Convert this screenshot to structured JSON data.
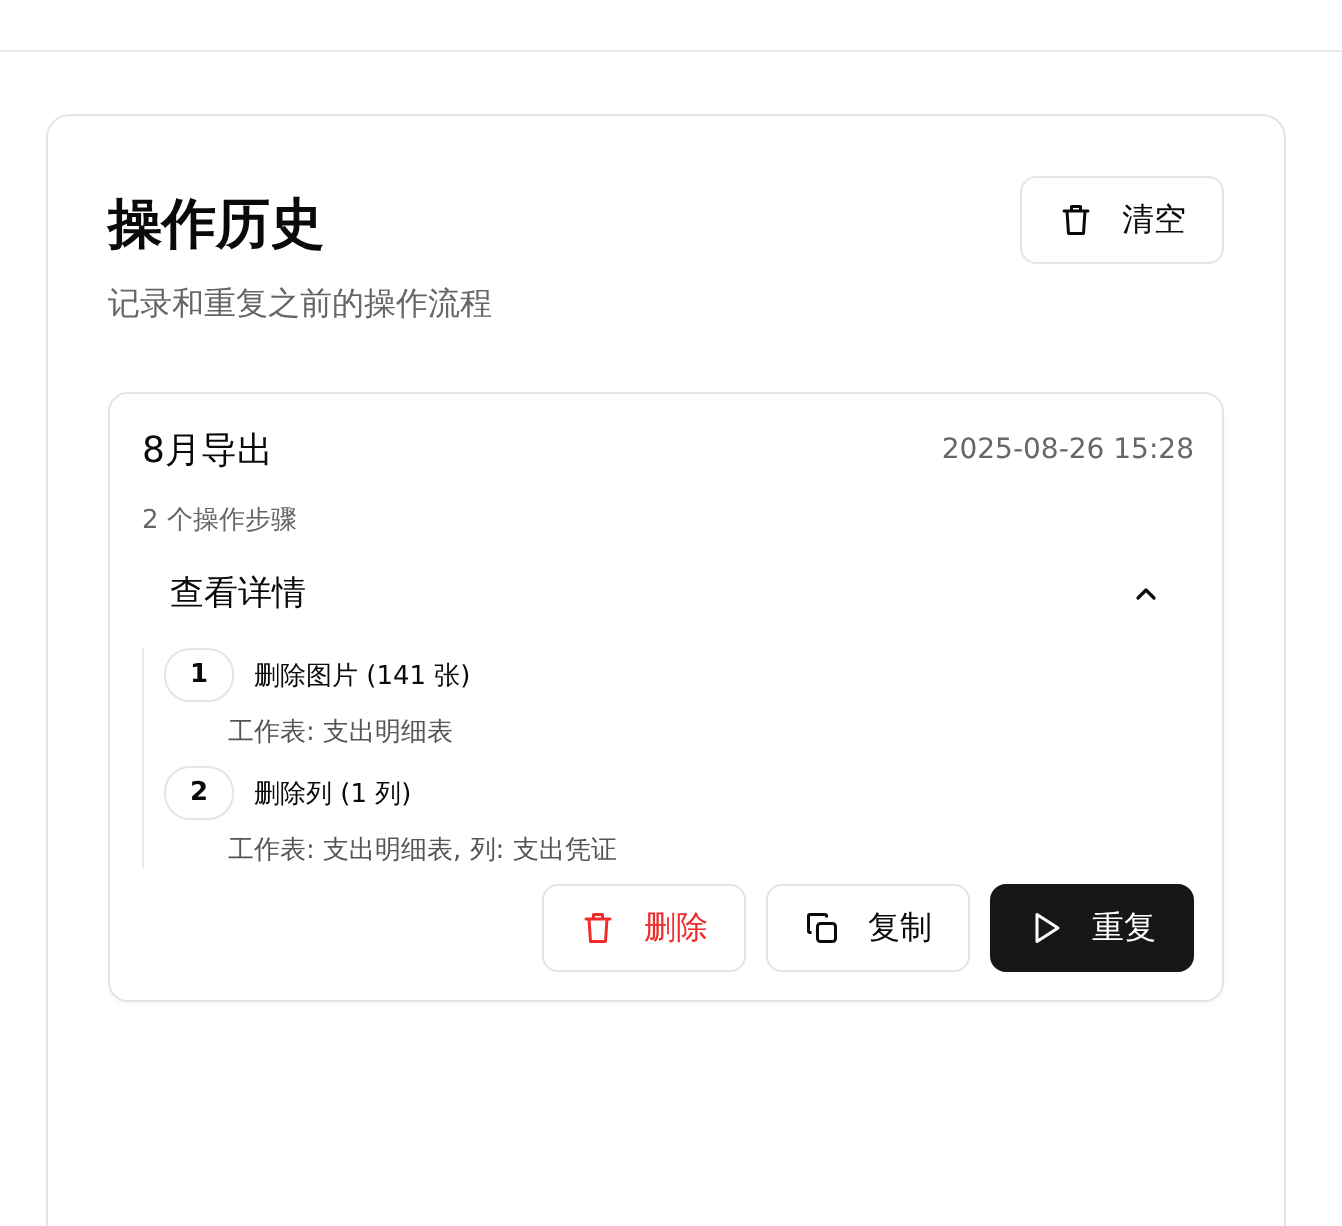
{
  "header": {
    "title": "操作历史",
    "subtitle": "记录和重复之前的操作流程",
    "clear_button": "清空"
  },
  "history": [
    {
      "name": "8月导出",
      "time": "2025-08-26 15:28",
      "step_count": "2 个操作步骤",
      "details_label": "查看详情",
      "expanded": true,
      "steps": [
        {
          "number": "1",
          "action": "删除图片 (141 张)",
          "detail": "工作表: 支出明细表"
        },
        {
          "number": "2",
          "action": "删除列 (1 列)",
          "detail": "工作表: 支出明细表, 列: 支出凭证"
        }
      ],
      "actions": [
        {
          "kind": "danger",
          "label": "删除"
        },
        {
          "kind": "outline",
          "label": "复制"
        },
        {
          "kind": "primary",
          "label": "重复"
        }
      ]
    }
  ]
}
